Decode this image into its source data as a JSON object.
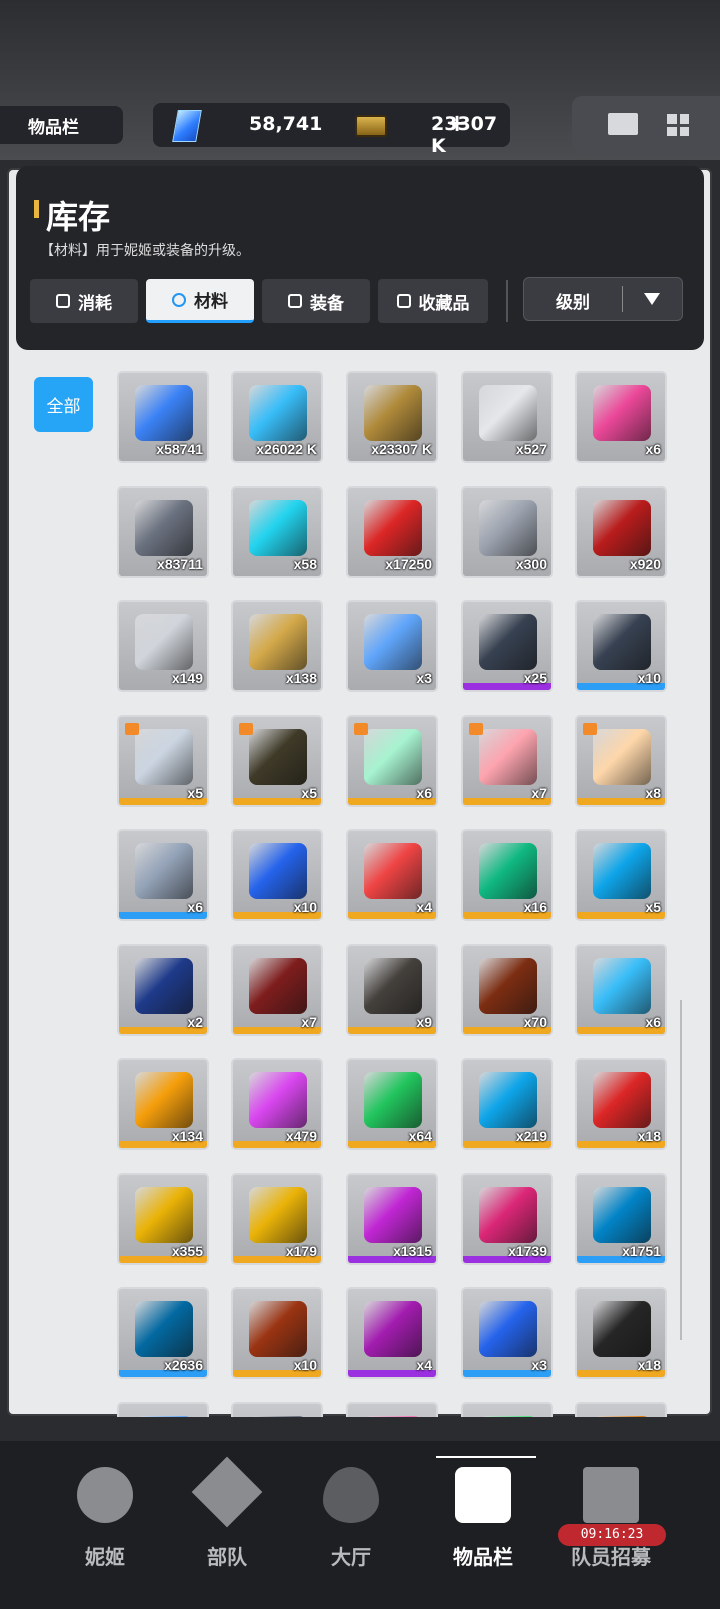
{
  "topbar": {
    "page_label": "物品栏",
    "gem_value": "58,741",
    "gem_plus": "+",
    "credit_value": "23307 K"
  },
  "header": {
    "title": "库存",
    "subtitle": "【材料】用于妮姬或装备的升级。",
    "tabs": [
      {
        "label": "消耗",
        "active": false
      },
      {
        "label": "材料",
        "active": true
      },
      {
        "label": "装备",
        "active": false
      },
      {
        "label": "收藏品",
        "active": false
      }
    ],
    "sort_label": "级别"
  },
  "filter_all": "全部",
  "items": [
    {
      "count": "x58741",
      "color": "#3b82f6",
      "bar": ""
    },
    {
      "count": "x26022 K",
      "color": "#38bdf8",
      "bar": ""
    },
    {
      "count": "x23307 K",
      "color": "#b08a3a",
      "bar": ""
    },
    {
      "count": "x527",
      "color": "#e5e7eb",
      "bar": ""
    },
    {
      "count": "x6",
      "color": "#ec4899",
      "bar": ""
    },
    {
      "count": "x83711",
      "color": "#6b7280",
      "bar": ""
    },
    {
      "count": "x58",
      "color": "#22d3ee",
      "bar": ""
    },
    {
      "count": "x17250",
      "color": "#dc2626",
      "bar": ""
    },
    {
      "count": "x300",
      "color": "#9ca3af",
      "bar": ""
    },
    {
      "count": "x920",
      "color": "#b91c1c",
      "bar": ""
    },
    {
      "count": "x149",
      "color": "#d1d5db",
      "bar": ""
    },
    {
      "count": "x138",
      "color": "#d4a94a",
      "bar": ""
    },
    {
      "count": "x3",
      "color": "#60a5fa",
      "bar": ""
    },
    {
      "count": "x25",
      "color": "#374151",
      "bar": "#9b30e0"
    },
    {
      "count": "x10",
      "color": "#374151",
      "bar": "#2c9ef5"
    },
    {
      "count": "x5",
      "color": "#cbd5e1",
      "bar": "#f0a820",
      "gift": true
    },
    {
      "count": "x5",
      "color": "#3f3a28",
      "bar": "#f0a820",
      "gift": true
    },
    {
      "count": "x6",
      "color": "#a7f3d0",
      "bar": "#f0a820",
      "gift": true
    },
    {
      "count": "x7",
      "color": "#fda4af",
      "bar": "#f0a820",
      "gift": true
    },
    {
      "count": "x8",
      "color": "#fed7aa",
      "bar": "#f0a820",
      "gift": true
    },
    {
      "count": "x6",
      "color": "#94a3b8",
      "bar": "#2c9ef5"
    },
    {
      "count": "x10",
      "color": "#2563eb",
      "bar": "#f0a820"
    },
    {
      "count": "x4",
      "color": "#ef4444",
      "bar": "#f0a820"
    },
    {
      "count": "x16",
      "color": "#10b981",
      "bar": "#f0a820"
    },
    {
      "count": "x5",
      "color": "#0ea5e9",
      "bar": "#f0a820"
    },
    {
      "count": "x2",
      "color": "#1e3a8a",
      "bar": "#f0a820"
    },
    {
      "count": "x7",
      "color": "#7f1d1d",
      "bar": "#f0a820"
    },
    {
      "count": "x9",
      "color": "#44403c",
      "bar": "#f0a820"
    },
    {
      "count": "x70",
      "color": "#7c2d12",
      "bar": "#f0a820"
    },
    {
      "count": "x6",
      "color": "#38bdf8",
      "bar": "#f0a820"
    },
    {
      "count": "x134",
      "color": "#f59e0b",
      "bar": "#f0a820"
    },
    {
      "count": "x479",
      "color": "#d946ef",
      "bar": "#f0a820"
    },
    {
      "count": "x64",
      "color": "#22c55e",
      "bar": "#f0a820"
    },
    {
      "count": "x219",
      "color": "#0ea5e9",
      "bar": "#f0a820"
    },
    {
      "count": "x18",
      "color": "#dc2626",
      "bar": "#f0a820"
    },
    {
      "count": "x355",
      "color": "#eab308",
      "bar": "#f0a820"
    },
    {
      "count": "x179",
      "color": "#eab308",
      "bar": "#f0a820"
    },
    {
      "count": "x1315",
      "color": "#c026d3",
      "bar": "#9b30e0"
    },
    {
      "count": "x1739",
      "color": "#db2777",
      "bar": "#9b30e0"
    },
    {
      "count": "x1751",
      "color": "#0284c7",
      "bar": "#2c9ef5"
    },
    {
      "count": "x2636",
      "color": "#0369a1",
      "bar": "#2c9ef5"
    },
    {
      "count": "x10",
      "color": "#9a3412",
      "bar": "#f0a820"
    },
    {
      "count": "x4",
      "color": "#a21caf",
      "bar": "#9b30e0"
    },
    {
      "count": "x3",
      "color": "#2563eb",
      "bar": "#2c9ef5"
    },
    {
      "count": "x18",
      "color": "#262626",
      "bar": "#f0a820"
    },
    {
      "count": "",
      "color": "#60a5fa",
      "bar": ""
    },
    {
      "count": "",
      "color": "#6b7280",
      "bar": ""
    },
    {
      "count": "",
      "color": "#f472b6",
      "bar": ""
    },
    {
      "count": "",
      "color": "#4ade80",
      "bar": ""
    },
    {
      "count": "",
      "color": "#d97706",
      "bar": ""
    }
  ],
  "nav": {
    "items": [
      {
        "label": "妮姬",
        "icon": "nikke-icon",
        "active": false
      },
      {
        "label": "部队",
        "icon": "squad-icon",
        "active": false
      },
      {
        "label": "大厅",
        "icon": "lobby-icon",
        "active": false
      },
      {
        "label": "物品栏",
        "icon": "inventory-icon",
        "active": true
      },
      {
        "label": "队员招募",
        "icon": "recruit-icon",
        "active": false
      }
    ],
    "recruit_timer": "09:16:23"
  }
}
